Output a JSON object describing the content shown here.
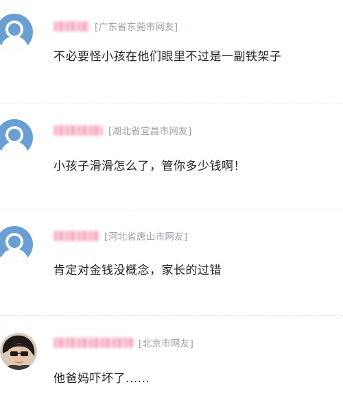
{
  "comments": [
    {
      "location": "[广东省东莞市网友]",
      "text": "不必要怪小孩在他们眼里不过是一副铁架子",
      "avatar_icon": "default-avatar-icon"
    },
    {
      "location": "[湖北省宜昌市网友]",
      "text": "小孩子滑滑怎么了，管你多少钱啊！",
      "avatar_icon": "default-avatar-icon"
    },
    {
      "location": "[河北省唐山市网友]",
      "text": "肯定对金钱没概念，家长的过错",
      "avatar_icon": "default-avatar-icon"
    },
    {
      "location": "[北京市网友]",
      "text": "他爸妈吓坏了......",
      "avatar_icon": "user-photo-avatar"
    }
  ],
  "colors": {
    "avatar_blue": "#6a9fd4",
    "location_gray": "#9aa0a6",
    "text_dark": "#222222"
  }
}
